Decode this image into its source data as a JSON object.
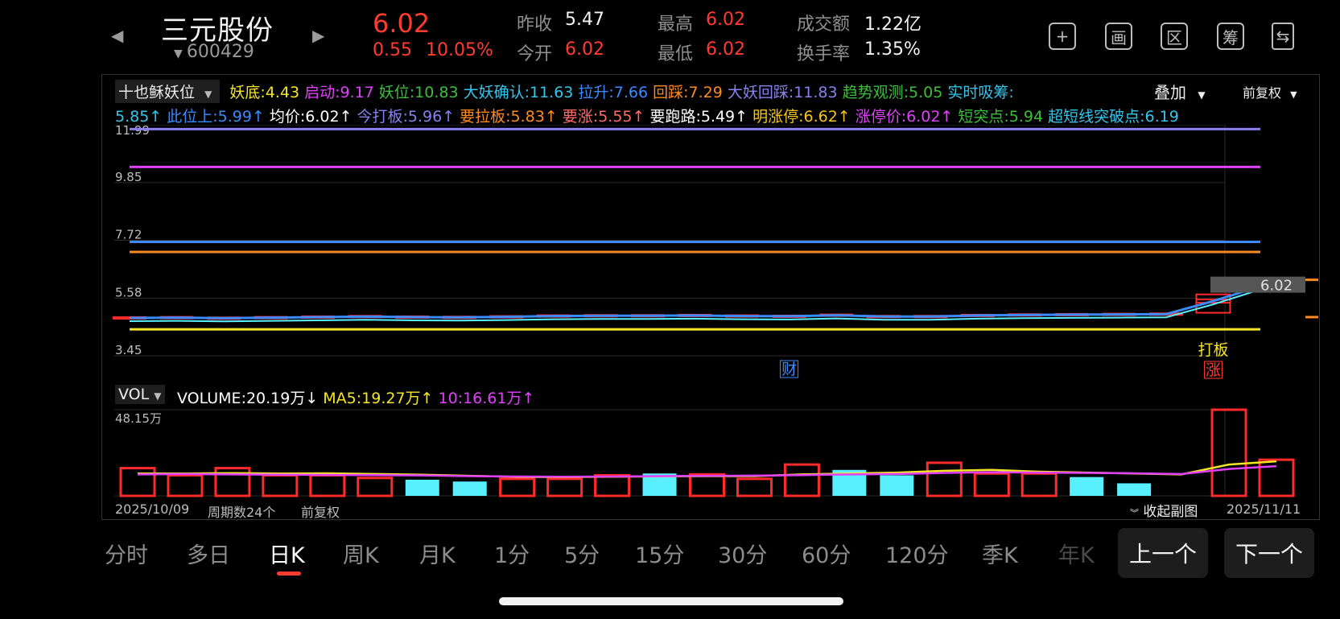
{
  "header": {
    "name": "三元股份",
    "code": "600429",
    "price": "6.02",
    "change": "0.55",
    "change_pct": "10.05%",
    "quotes": [
      {
        "label": "昨收",
        "value": "5.47",
        "color": "#f2f2f2"
      },
      {
        "label": "今开",
        "value": "6.02",
        "color": "#ff3b30"
      },
      {
        "label": "最高",
        "value": "6.02",
        "color": "#ff3b30"
      },
      {
        "label": "最低",
        "value": "6.02",
        "color": "#ff3b30"
      },
      {
        "label": "成交额",
        "value": "1.22亿",
        "color": "#f2f2f2"
      },
      {
        "label": "换手率",
        "value": "1.35%",
        "color": "#f2f2f2"
      }
    ],
    "tools": [
      {
        "name": "add-icon",
        "glyph": "+"
      },
      {
        "name": "draw-icon",
        "glyph": "画"
      },
      {
        "name": "interval-icon",
        "glyph": "区"
      },
      {
        "name": "chips-icon",
        "glyph": "筹"
      },
      {
        "name": "rotate-screen-icon",
        "glyph": "⇆"
      }
    ]
  },
  "indicator": {
    "selector": "十也稣妖位",
    "overlay": "叠加",
    "adjust": "前复权",
    "row1": [
      {
        "text": "妖底:4.43",
        "color": "#f5e625"
      },
      {
        "text": "启动:9.17",
        "color": "#e040fb"
      },
      {
        "text": "妖位:10.83",
        "color": "#3bbf3b"
      },
      {
        "text": "大妖确认:11.63",
        "color": "#35c5ea"
      },
      {
        "text": "拉升:7.66",
        "color": "#3b8bff"
      },
      {
        "text": "回踩:7.29",
        "color": "#ff8a1e"
      },
      {
        "text": "大妖回踩:11.83",
        "color": "#8c7ff0"
      },
      {
        "text": "趋势观测:5.05",
        "color": "#3bbf3b"
      },
      {
        "text": "实时吸筹:",
        "color": "#35c5ea"
      }
    ],
    "row2": [
      {
        "text": "5.85↑",
        "color": "#35c5ea"
      },
      {
        "text": "此位上:5.99↑",
        "color": "#3b8bff"
      },
      {
        "text": "均价:6.02↑",
        "color": "#ffffff"
      },
      {
        "text": "今打板:5.96↑",
        "color": "#8c7ff0"
      },
      {
        "text": "要拉板:5.83↑",
        "color": "#ff8a1e"
      },
      {
        "text": "要涨:5.55↑",
        "color": "#ff6b6b"
      },
      {
        "text": "要跑路:5.49↑",
        "color": "#ffffff"
      },
      {
        "text": "明涨停:6.62↑",
        "color": "#f5c518"
      },
      {
        "text": "涨停价:6.02↑",
        "color": "#e040fb"
      },
      {
        "text": "短突点:5.94",
        "color": "#3bbf3b"
      },
      {
        "text": "超短线突破点:6.19",
        "color": "#35c5ea"
      }
    ]
  },
  "chart_data": [
    {
      "type": "candlestick",
      "y_ticks": [
        "11.99",
        "9.85",
        "7.72",
        "5.58",
        "3.45"
      ],
      "ylim": [
        3.45,
        11.99
      ],
      "last_price_tag": "6.02",
      "closes": [
        4.85,
        4.86,
        4.84,
        4.86,
        4.88,
        4.9,
        4.88,
        4.87,
        4.89,
        4.92,
        4.93,
        4.93,
        4.94,
        4.92,
        4.91,
        4.95,
        4.9,
        4.9,
        4.94,
        4.96,
        4.97,
        4.98,
        4.99,
        5.47,
        6.02
      ],
      "horizontal_lines": [
        {
          "value": 11.83,
          "color": "#8c7ff0"
        },
        {
          "value": 10.43,
          "color": "#e040fb"
        },
        {
          "value": 7.66,
          "color": "#3b8bff"
        },
        {
          "value": 7.29,
          "color": "#ff8a1e"
        },
        {
          "value": 4.43,
          "color": "#f5e625"
        }
      ],
      "annotations": [
        {
          "text": "财",
          "color": "#3b8bff",
          "index": 14
        },
        {
          "text": "打板",
          "color": "#f5e625",
          "index": 23
        },
        {
          "text": "涨",
          "color": "#ff3b30",
          "index": 23
        }
      ]
    },
    {
      "type": "bar",
      "selector": "VOL",
      "legend": [
        {
          "text": "VOLUME:20.19万↓",
          "color": "#ffffff",
          "arrow_color": "#3bbf3b"
        },
        {
          "text": "MA5:19.27万↑",
          "color": "#f5e625",
          "arrow_color": "#ff3b30"
        },
        {
          "text": "10:16.61万↑",
          "color": "#e040fb",
          "arrow_color": "#ff3b30"
        }
      ],
      "y_max_label": "48.15万",
      "ylim": [
        0,
        48.15
      ],
      "volumes": [
        15.5,
        11.5,
        15.5,
        11.5,
        11.5,
        10,
        9,
        8,
        9.5,
        9.5,
        11.5,
        12.5,
        12,
        9.5,
        17.5,
        14.5,
        11.5,
        18.5,
        12.5,
        12.5,
        10.5,
        7,
        null,
        48.15,
        20.19
      ],
      "up_down": [
        "up",
        "up",
        "up",
        "up",
        "up",
        "up",
        "down",
        "down",
        "up",
        "up",
        "up",
        "down",
        "up",
        "up",
        "up",
        "down",
        "down",
        "up",
        "up",
        "up",
        "down",
        "down",
        "none",
        "up",
        "up"
      ],
      "ma5": [
        12.5,
        12.5,
        12.7,
        12.5,
        12.6,
        12.2,
        11.8,
        11.2,
        10.6,
        10.5,
        10.7,
        10.9,
        11.0,
        11.0,
        12.0,
        12.5,
        13.0,
        14.0,
        14.5,
        13.5,
        13.0,
        12.5,
        12.0,
        17.5,
        19.27
      ],
      "ma10": [
        12.0,
        12.2,
        12.0,
        11.8,
        11.7,
        11.6,
        11.4,
        11.0,
        10.8,
        10.7,
        10.8,
        11.0,
        11.2,
        11.3,
        11.6,
        12.0,
        12.2,
        12.8,
        13.2,
        13.0,
        12.8,
        12.6,
        12.2,
        15.0,
        16.61
      ],
      "bar_colors": {
        "up": "#ff2a2a",
        "down": "#58f0ff"
      },
      "ma_colors": {
        "ma5": "#f5e625",
        "ma10": "#e040fb"
      }
    }
  ],
  "footer": {
    "start_date": "2025/10/09",
    "period_count": "周期数24个",
    "adjust": "前复权",
    "collapse": "收起副图",
    "end_date": "2025/11/11"
  },
  "tabs": [
    {
      "label": "分时"
    },
    {
      "label": "多日"
    },
    {
      "label": "日K",
      "active": true
    },
    {
      "label": "周K"
    },
    {
      "label": "月K"
    },
    {
      "label": "1分"
    },
    {
      "label": "5分"
    },
    {
      "label": "15分"
    },
    {
      "label": "30分"
    },
    {
      "label": "60分"
    },
    {
      "label": "120分"
    },
    {
      "label": "季K"
    },
    {
      "label": "年K"
    }
  ],
  "pager": {
    "prev": "上一个",
    "next": "下一个"
  }
}
